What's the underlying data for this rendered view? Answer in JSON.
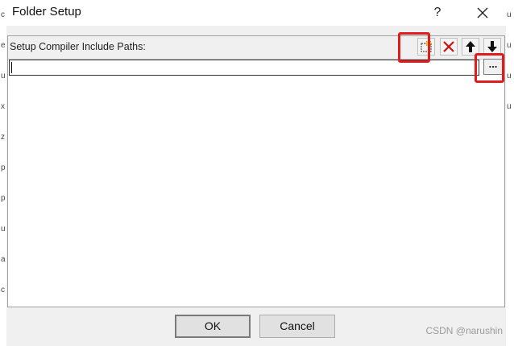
{
  "dialog": {
    "title": "Folder Setup",
    "help_label": "?",
    "close_label": "✕"
  },
  "panel": {
    "label": "Setup Compiler Include Paths:",
    "toolbar": {
      "new_icon": "new-folder-icon",
      "delete_icon": "delete-icon",
      "up_icon": "move-up-icon",
      "down_icon": "move-down-icon"
    },
    "path_input_value": "",
    "browse_label": "..."
  },
  "buttons": {
    "ok": "OK",
    "cancel": "Cancel"
  },
  "watermark": "CSDN @narushin",
  "colors": {
    "highlight": "#e21c1c",
    "delete": "#cc1111",
    "arrow": "#111111"
  }
}
